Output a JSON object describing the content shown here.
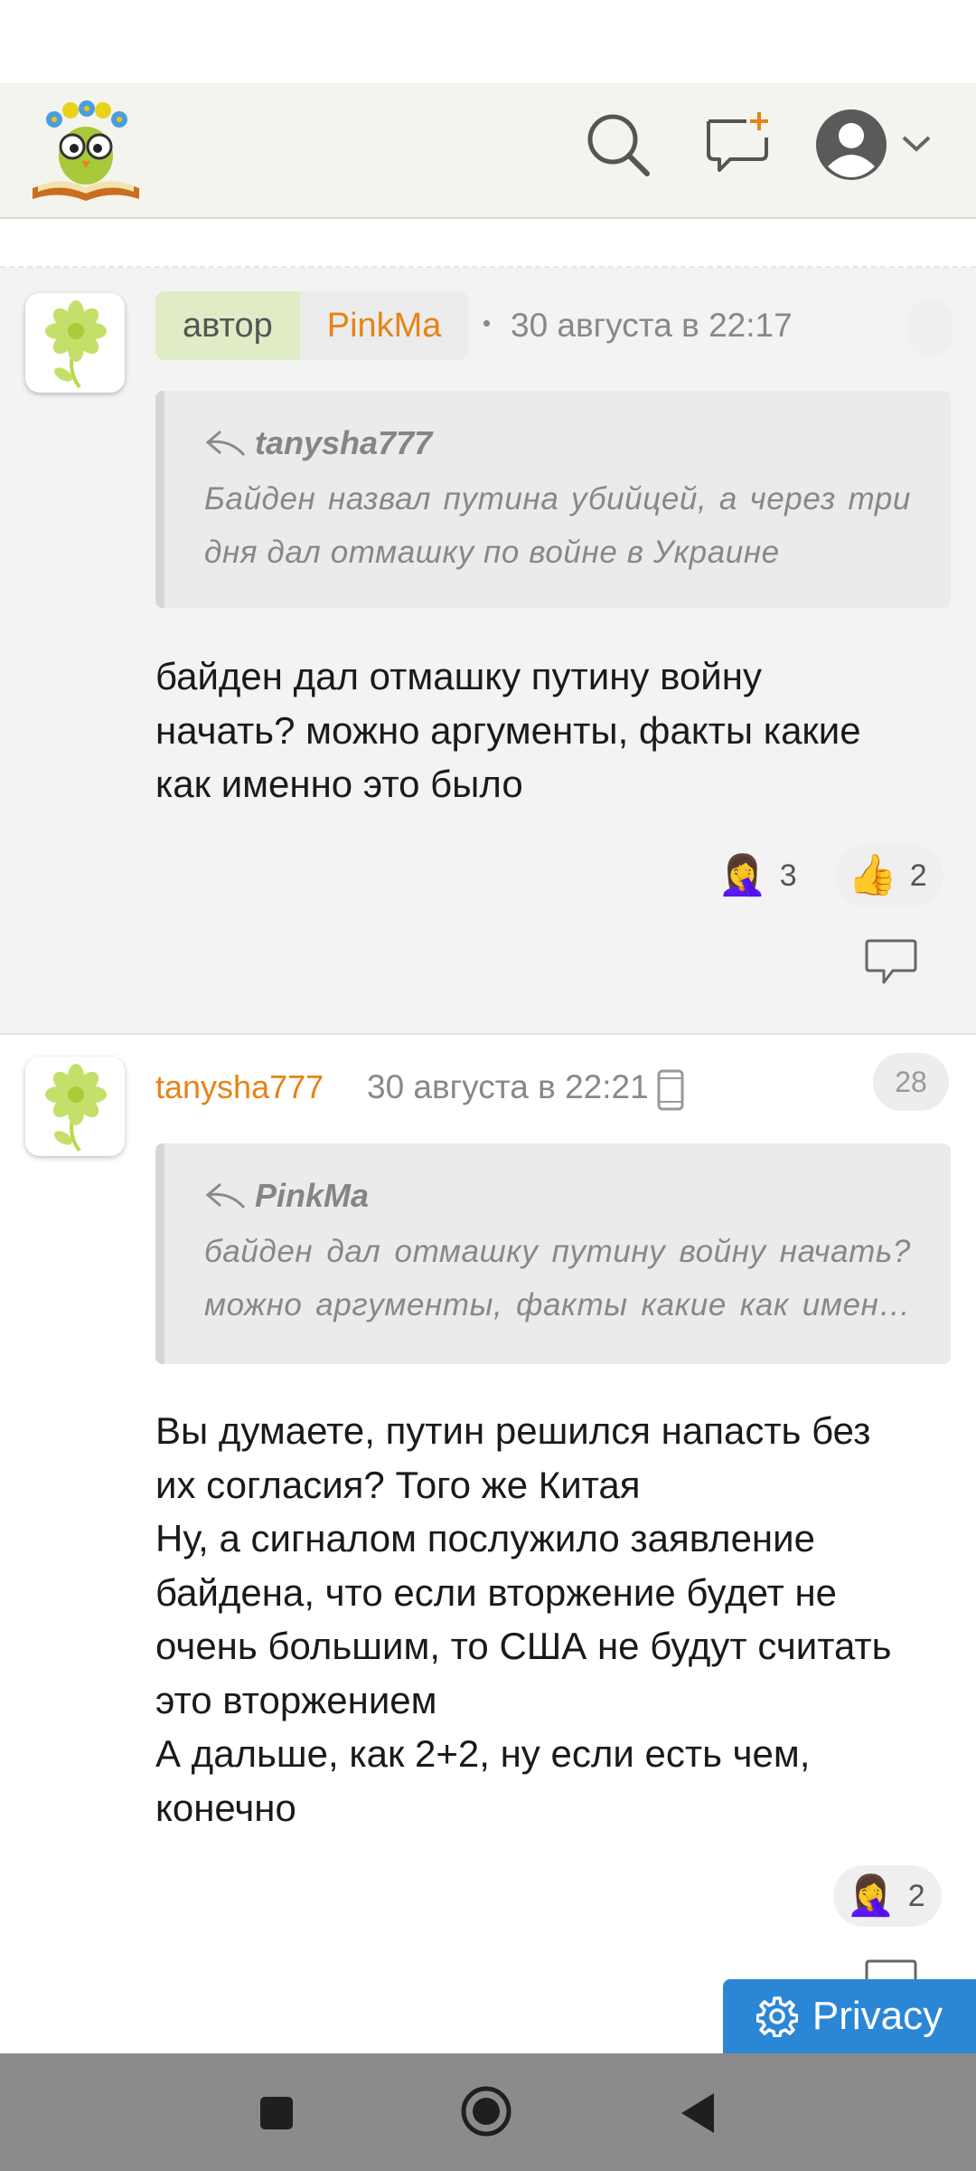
{
  "header": {
    "logo_icon": "owl-on-book-logo",
    "search_icon": "search-icon",
    "new_post_icon": "new-post-icon",
    "profile_icon": "user-avatar-icon",
    "profile_chevron": "chevron-down-icon"
  },
  "comments": [
    {
      "author_tag": "автор",
      "username": "PinkMa",
      "separator": "•",
      "date": "30 августа в 22:17",
      "quote": {
        "author": "tanysha777",
        "text": "Байден назвал путина убийцей, а через три дня дал отмашку по войне в Украине"
      },
      "body_lines": [
        "байден дал отмашку путину войну",
        "начать? можно аргументы, факты какие",
        "как именно это было"
      ],
      "reactions": [
        {
          "emoji": "🤦‍♀️",
          "count": "3"
        },
        {
          "emoji": "👍",
          "count": "2"
        }
      ]
    },
    {
      "username": "tanysha777",
      "date": "30 августа в 22:21",
      "device_icon": "mobile-phone-icon",
      "corner_count": "28",
      "quote": {
        "author": "PinkMa",
        "text_line1": "байден дал отмашку путину войну начать?",
        "text_line2": "можно аргументы, факты какие как имен…"
      },
      "body_lines": [
        "Вы думаете, путин решился напасть без",
        "их согласия? Того же Китая",
        "Ну, а сигналом послужило заявление",
        "байдена, что если вторжение будет не",
        "очень большим, то США не будут считать",
        "это вторжением",
        "А дальше, как 2+2, ну если есть чем,",
        "конечно"
      ],
      "reactions": [
        {
          "emoji": "🤦‍♀️",
          "count": "2"
        }
      ]
    }
  ],
  "privacy_button": {
    "label": "Privacy",
    "icon": "gear-icon"
  },
  "navbar": {
    "recents": "square-icon",
    "home": "circle-icon",
    "back": "triangle-back-icon"
  },
  "colors": {
    "username": "#e68316",
    "author_badge": "#e0ecc6",
    "privacy": "#2b86d6",
    "header_bg": "#f4f4ee"
  }
}
